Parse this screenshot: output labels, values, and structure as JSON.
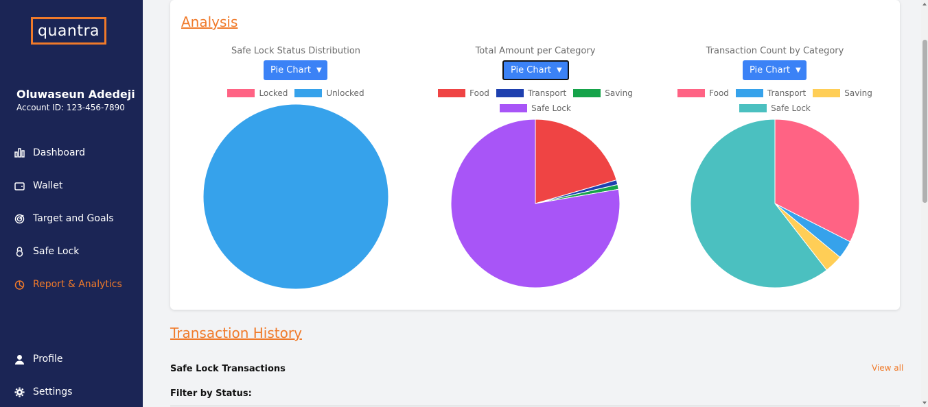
{
  "sidebar": {
    "logo": "quantra",
    "user_name": "Oluwaseun Adedeji",
    "account_id": "Account ID: 123-456-7890",
    "items": [
      {
        "label": "Dashboard",
        "icon": "bar-chart-icon",
        "active": false
      },
      {
        "label": "Wallet",
        "icon": "wallet-icon",
        "active": false
      },
      {
        "label": "Target and Goals",
        "icon": "target-icon",
        "active": false
      },
      {
        "label": "Safe Lock",
        "icon": "lock-icon",
        "active": false
      },
      {
        "label": "Report & Analytics",
        "icon": "pie-chart-icon",
        "active": true
      },
      {
        "label": "Profile",
        "icon": "user-icon",
        "active": false
      },
      {
        "label": "Settings",
        "icon": "gear-icon",
        "active": false
      }
    ]
  },
  "analysis": {
    "title": "Analysis"
  },
  "charts": {
    "select_label": "Pie Chart"
  },
  "chart_data": [
    {
      "type": "pie",
      "title": "Safe Lock Status Distribution",
      "labels": [
        "Locked",
        "Unlocked"
      ],
      "values": [
        0,
        100
      ],
      "colors": [
        "#ff6384",
        "#36a2eb"
      ]
    },
    {
      "type": "pie",
      "title": "Total Amount per Category",
      "labels": [
        "Food",
        "Transport",
        "Saving",
        "Safe Lock"
      ],
      "values": [
        20.5,
        0.9,
        0.9,
        77.7
      ],
      "colors": [
        "#ef4444",
        "#1e40af",
        "#16a34a",
        "#a855f7"
      ]
    },
    {
      "type": "pie",
      "title": "Transaction Count by Category",
      "labels": [
        "Food",
        "Transport",
        "Saving",
        "Safe Lock"
      ],
      "values": [
        32.5,
        3.5,
        3.5,
        60.5
      ],
      "colors": [
        "#ff6384",
        "#36a2eb",
        "#ffce56",
        "#4bc0c0"
      ]
    }
  ],
  "transactions": {
    "title": "Transaction History",
    "subtitle": "Safe Lock Transactions",
    "view_all": "View all",
    "filter_label": "Filter by Status:"
  }
}
